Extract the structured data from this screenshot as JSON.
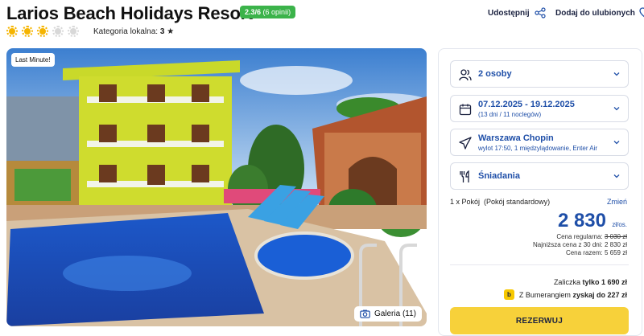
{
  "hotel": {
    "name": "Larios Beach Holidays Resort",
    "rating": "2.3/6",
    "reviews": "(6 opinii)",
    "suns_on": 3,
    "suns_total": 5,
    "local_category_label": "Kategoria lokalna:",
    "local_category_value": "3"
  },
  "actions": {
    "share_label": "Udostępnij",
    "favorite_label": "Dodaj do ulubionych"
  },
  "photo": {
    "badge": "Last Minute!",
    "gallery_label": "Galeria (11)"
  },
  "booking": {
    "persons": "2 osoby",
    "dates": "07.12.2025 - 19.12.2025",
    "dates_sub": "(13 dni / 11 noclegów)",
    "departure": "Warszawa Chopin",
    "departure_sub": "wylot 17:50, 1 międzylądowanie, Enter Air",
    "board": "Śniadania",
    "room_label": "1 x Pokój",
    "room_type": "(Pokój standardowy)",
    "change_label": "Zmień",
    "price": "2 830",
    "price_unit": "zł/os.",
    "regular_label": "Cena regularna:",
    "regular_value": "3 030 zł",
    "lowest_label": "Najniższa cena z 30 dni:",
    "lowest_value": "2 830 zł",
    "total_label": "Cena razem:",
    "total_value": "5 659 zł",
    "deposit_label": "Zaliczka",
    "deposit_value": "tylko 1 690 zł",
    "bumerang_prefix": "Z Bumerangiem",
    "bumerang_value": "zyskaj do 227 zł",
    "reserve_label": "REZERWUJ"
  },
  "colors": {
    "accent_blue": "#1f4fa8",
    "rating_green": "#3bb34a",
    "reserve_yellow": "#f7d13a",
    "sun_yellow": "#f5b400"
  }
}
